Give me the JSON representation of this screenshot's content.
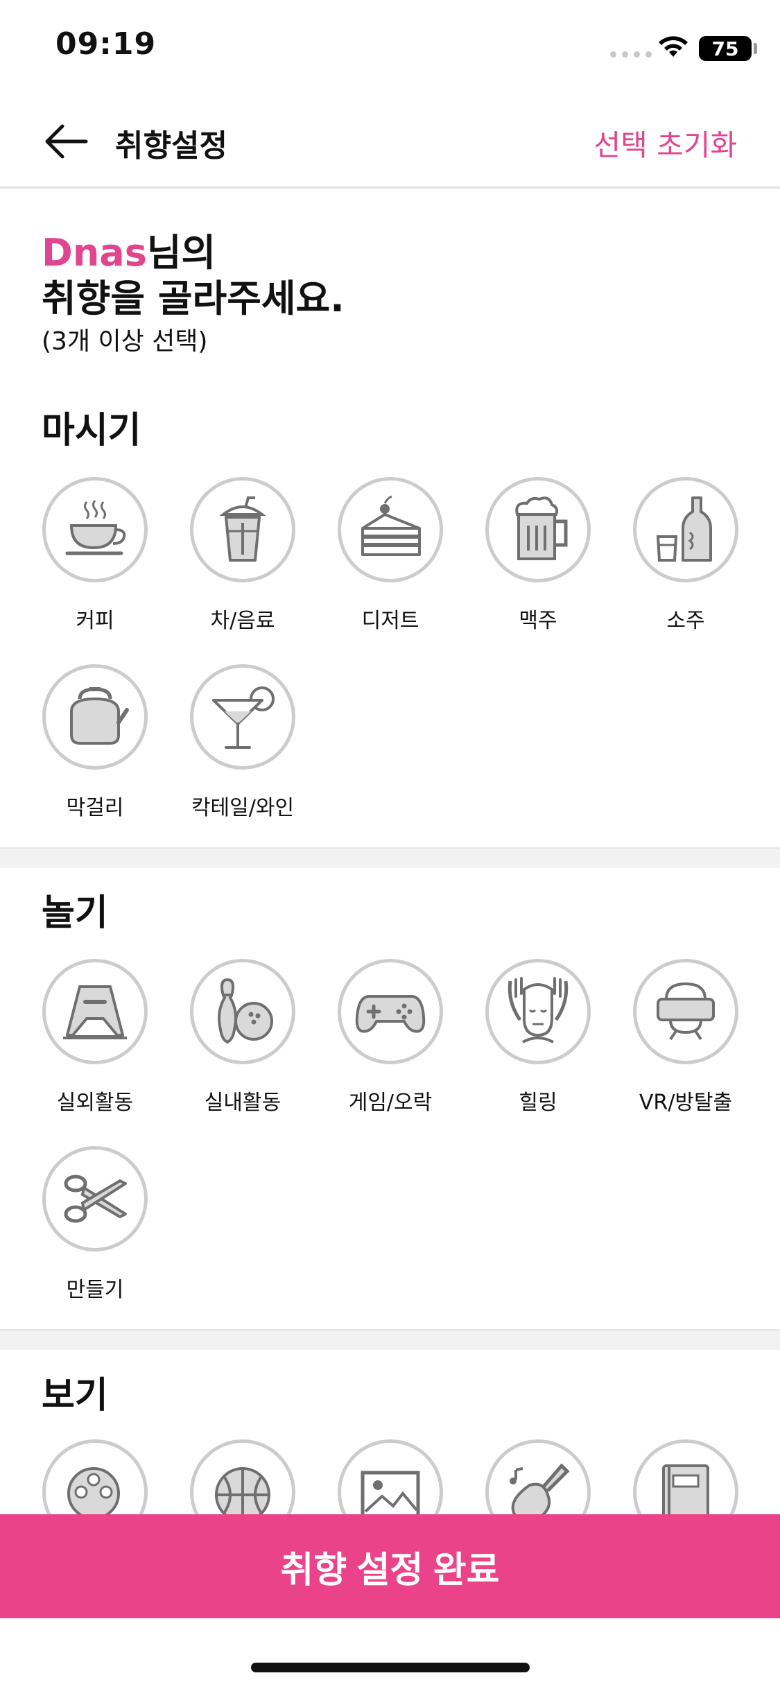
{
  "status_bar": {
    "time": "09:19",
    "battery": "75"
  },
  "header": {
    "title": "취향설정",
    "reset_label": "선택 초기화"
  },
  "intro": {
    "name": "Dnas",
    "suffix": "님의",
    "line2": "취향을 골라주세요.",
    "hint": "(3개 이상 선택)"
  },
  "sections": [
    {
      "title": "마시기",
      "items": [
        {
          "label": "커피",
          "icon": "coffee-cup-icon"
        },
        {
          "label": "차/음료",
          "icon": "drink-cup-icon"
        },
        {
          "label": "디저트",
          "icon": "cake-icon"
        },
        {
          "label": "맥주",
          "icon": "beer-mug-icon"
        },
        {
          "label": "소주",
          "icon": "soju-bottle-icon"
        },
        {
          "label": "막걸리",
          "icon": "kettle-icon"
        },
        {
          "label": "칵테일/와인",
          "icon": "cocktail-icon"
        }
      ]
    },
    {
      "title": "놀기",
      "items": [
        {
          "label": "실외활동",
          "icon": "tent-icon"
        },
        {
          "label": "실내활동",
          "icon": "bowling-icon"
        },
        {
          "label": "게임/오락",
          "icon": "gamepad-icon"
        },
        {
          "label": "힐링",
          "icon": "massage-face-icon"
        },
        {
          "label": "VR/방탈출",
          "icon": "vr-headset-icon"
        },
        {
          "label": "만들기",
          "icon": "scissors-icon"
        }
      ]
    },
    {
      "title": "보기",
      "items": [
        {
          "icon": "film-reel-icon"
        },
        {
          "icon": "basketball-icon"
        },
        {
          "icon": "picture-icon"
        },
        {
          "icon": "guitar-icon"
        },
        {
          "icon": "book-icon"
        }
      ]
    }
  ],
  "cta_label": "취향 설정 완료",
  "colors": {
    "accent": "#e2458f",
    "cta": "#ea4389",
    "circle_border": "#cccccc",
    "icon": "#6f6f6f"
  }
}
